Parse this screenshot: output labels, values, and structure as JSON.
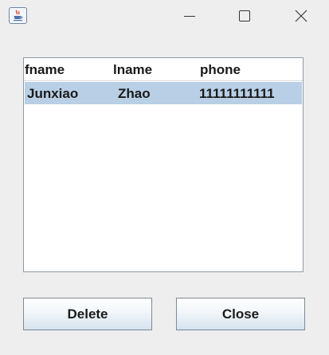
{
  "window": {
    "icons": {
      "app": "java-cup-icon",
      "minimize": "minimize-icon",
      "maximize": "maximize-icon",
      "close": "close-icon"
    }
  },
  "table": {
    "columns": [
      "fname",
      "lname",
      "phone"
    ],
    "rows": [
      {
        "fname": "Junxiao",
        "lname": "Zhao",
        "phone": "11111111111",
        "selected": true
      }
    ],
    "selection_color": "#b8cfe5"
  },
  "buttons": {
    "delete_label": "Delete",
    "close_label": "Close"
  }
}
